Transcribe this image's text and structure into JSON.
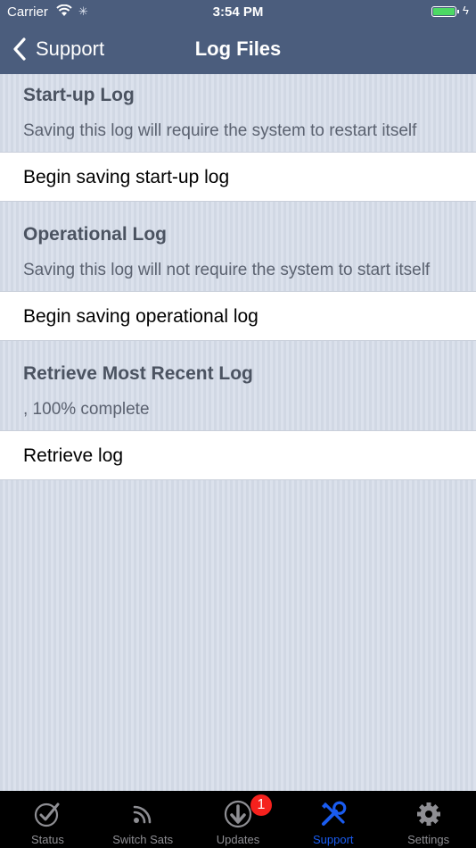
{
  "status_bar": {
    "carrier": "Carrier",
    "time": "3:54 PM"
  },
  "nav": {
    "back_label": "Support",
    "title": "Log Files"
  },
  "sections": [
    {
      "title": "Start-up Log",
      "description": "Saving this log will require the system to restart itself",
      "action": "Begin saving start-up log"
    },
    {
      "title": "Operational Log",
      "description": "Saving this log will not require the system to start itself",
      "action": "Begin saving operational log"
    },
    {
      "title": "Retrieve Most Recent Log",
      "description": ", 100% complete",
      "action": "Retrieve log"
    }
  ],
  "tabs": [
    {
      "label": "Status",
      "icon": "checkmark-circle-icon"
    },
    {
      "label": "Switch Sats",
      "icon": "satellite-signal-icon"
    },
    {
      "label": "Updates",
      "icon": "download-icon",
      "badge": "1"
    },
    {
      "label": "Support",
      "icon": "tools-icon",
      "active": true
    },
    {
      "label": "Settings",
      "icon": "gear-icon"
    }
  ],
  "colors": {
    "nav_bg": "#4b5d7d",
    "active_tab": "#1a5cf0",
    "badge": "#f5211d",
    "battery": "#4cd964"
  }
}
